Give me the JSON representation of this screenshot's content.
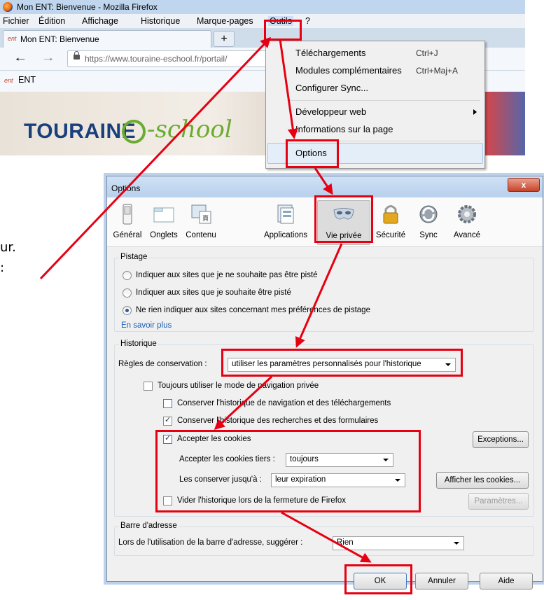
{
  "firefox": {
    "window_title": "Mon ENT: Bienvenue - Mozilla Firefox",
    "menus": [
      "Fichier",
      "Édition",
      "Affichage",
      "Historique",
      "Marque-pages",
      "Outils",
      "?"
    ],
    "tab_favicon": "ent",
    "tab_label": "Mon ENT: Bienvenue",
    "new_tab": "+",
    "url": "https://www.touraine-eschool.fr/portail/",
    "bookmark_favicon": "ent",
    "bookmark_label": "ENT",
    "site_logo_main": "TOURAINE",
    "site_logo_sub": "-school"
  },
  "tools_menu": {
    "items": [
      {
        "label": "Téléchargements",
        "shortcut": "Ctrl+J"
      },
      {
        "label": "Modules complémentaires",
        "shortcut": "Ctrl+Maj+A"
      },
      {
        "label": "Configurer Sync..."
      },
      {
        "label": "Développeur web"
      },
      {
        "label": "Informations sur la page"
      },
      {
        "label": "Options"
      }
    ]
  },
  "left_text": {
    "line1": "ur.",
    "line2": ":"
  },
  "options": {
    "title": "Options",
    "close": "x",
    "tabs": [
      "Général",
      "Onglets",
      "Contenu",
      "Applications",
      "Vie privée",
      "Sécurité",
      "Sync",
      "Avancé"
    ],
    "selected_tab": "Vie privée",
    "tracking": {
      "title": "Pistage",
      "opt1": "Indiquer aux sites que je ne souhaite pas être pisté",
      "opt2": "Indiquer aux sites que je souhaite être pisté",
      "opt3": "Ne rien indiquer aux sites concernant mes préférences de pistage",
      "learn_more": "En savoir plus"
    },
    "history": {
      "title": "Historique",
      "rules_label": "Règles de conservation :",
      "rules_value": "utiliser les paramètres personnalisés pour l'historique",
      "private": "Toujours utiliser le mode de navigation privée",
      "keep_nav": "Conserver l'historique de navigation et des téléchargements",
      "keep_search": "Conserver l'historique des recherches et des formulaires",
      "accept_cookies": "Accepter les cookies",
      "exceptions": "Exceptions...",
      "third_party_label": "Accepter les cookies tiers :",
      "third_party_value": "toujours",
      "keep_until_label": "Les conserver jusqu'à :",
      "keep_until_value": "leur expiration",
      "show_cookies": "Afficher les cookies...",
      "clear_on_close": "Vider l'historique lors de la fermeture de Firefox",
      "settings": "Paramètres..."
    },
    "address_bar": {
      "title": "Barre d'adresse",
      "label": "Lors de l'utilisation de la barre d'adresse, suggérer :",
      "value": "Rien"
    },
    "buttons": {
      "ok": "OK",
      "cancel": "Annuler",
      "help": "Aide"
    }
  },
  "colors": {
    "highlight_red": "#e60012",
    "link_blue": "#1a5fb4",
    "selection_blue": "#e4eef9"
  }
}
